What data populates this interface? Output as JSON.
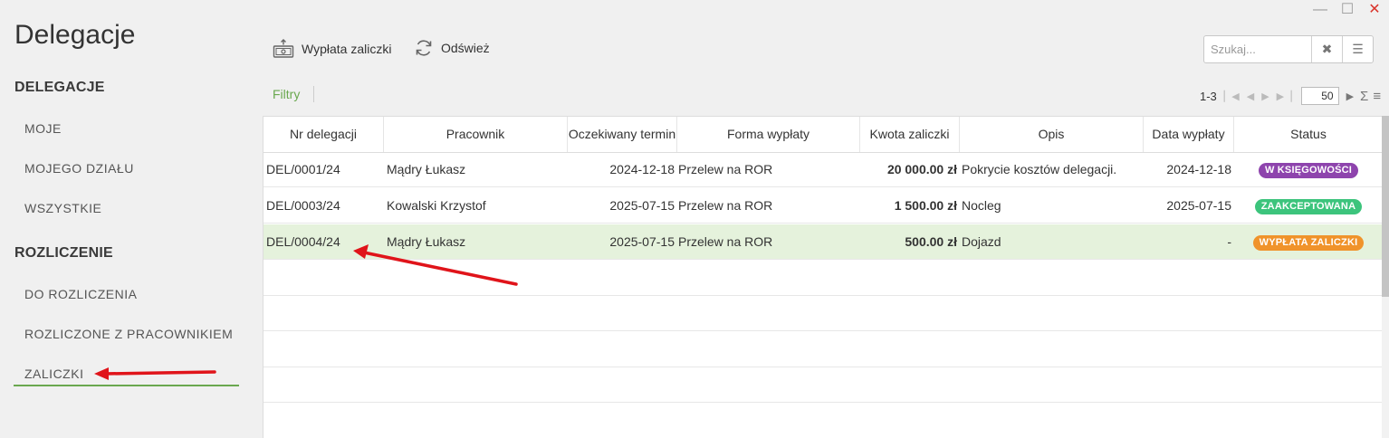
{
  "window": {
    "minimize": "—",
    "maximize": "☐",
    "close": "✕"
  },
  "app_title": "Delegacje",
  "sidebar": {
    "sections": [
      {
        "title": "DELEGACJE",
        "items": [
          {
            "label": "MOJE"
          },
          {
            "label": "MOJEGO DZIAŁU"
          },
          {
            "label": "WSZYSTKIE"
          }
        ]
      },
      {
        "title": "ROZLICZENIE",
        "items": [
          {
            "label": "DO ROZLICZENIA"
          },
          {
            "label": "ROZLICZONE Z PRACOWNIKIEM"
          },
          {
            "label": "ZALICZKI",
            "active": true
          }
        ]
      }
    ]
  },
  "toolbar": {
    "payout_label": "Wypłata zaliczki",
    "refresh_label": "Odśwież"
  },
  "search": {
    "placeholder": "Szukaj..."
  },
  "filters_label": "Filtry",
  "pager": {
    "range": "1-3",
    "page_size": "50"
  },
  "table": {
    "columns": [
      "Nr delegacji",
      "Pracownik",
      "Oczekiwany termin",
      "Forma wypłaty",
      "Kwota zaliczki",
      "Opis",
      "Data wypłaty",
      "Status"
    ],
    "rows": [
      {
        "nr": "DEL/0001/24",
        "employee": "Mądry Łukasz",
        "term": "2024-12-18",
        "form": "Przelew na ROR",
        "amount": "20 000.00 zł",
        "desc": "Pokrycie kosztów delegacji.",
        "paid": "2024-12-18",
        "status": "W KSIĘGOWOŚCI",
        "status_color": "#8e44ad"
      },
      {
        "nr": "DEL/0003/24",
        "employee": "Kowalski Krzystof",
        "term": "2025-07-15",
        "form": "Przelew na ROR",
        "amount": "1 500.00 zł",
        "desc": "Nocleg",
        "paid": "2025-07-15",
        "status": "ZAAKCEPTOWANA",
        "status_color": "#3cc47c"
      },
      {
        "nr": "DEL/0004/24",
        "employee": "Mądry Łukasz",
        "term": "2025-07-15",
        "form": "Przelew na ROR",
        "amount": "500.00 zł",
        "desc": "Dojazd",
        "paid": "-",
        "status": "WYPŁATA ZALICZKI",
        "status_color": "#f0932b",
        "selected": true
      }
    ]
  },
  "colors": {
    "accent_green": "#6aa84f",
    "annotation_red": "#e0141a",
    "selected_row": "#e5f2dc"
  }
}
